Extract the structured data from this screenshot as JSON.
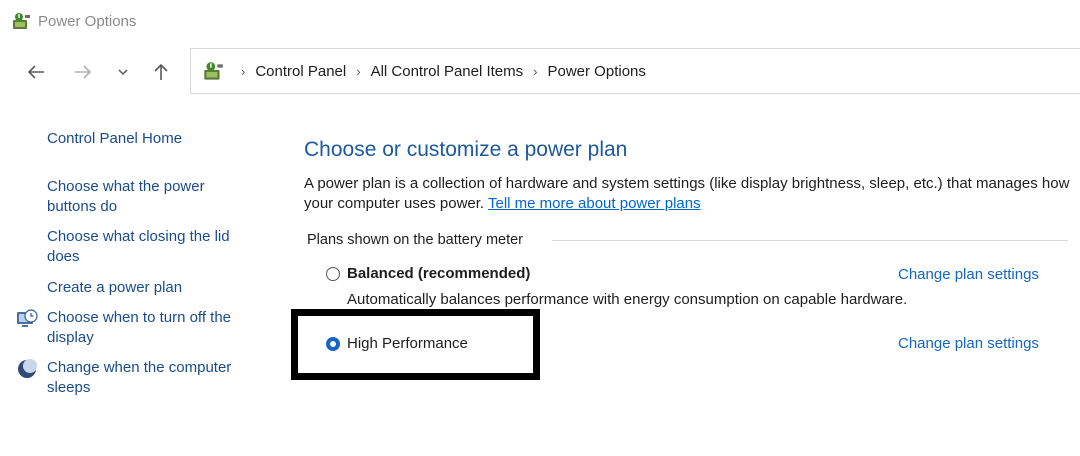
{
  "window": {
    "title": "Power Options",
    "title_icon": "power-options-icon"
  },
  "nav": {
    "back_icon": "back-arrow-icon",
    "forward_icon": "forward-arrow-icon",
    "recent_icon": "chevron-down-icon",
    "up_icon": "up-arrow-icon",
    "breadcrumbs": [
      "Control Panel",
      "All Control Panel Items",
      "Power Options"
    ],
    "separator": "›"
  },
  "sidebar": {
    "items": [
      {
        "label": "Control Panel Home",
        "icon": ""
      },
      {
        "label": "Choose what the power buttons do",
        "icon": ""
      },
      {
        "label": "Choose what closing the lid does",
        "icon": ""
      },
      {
        "label": "Create a power plan",
        "icon": ""
      },
      {
        "label": "Choose when to turn off the display",
        "icon": "display-schedule-icon"
      },
      {
        "label": "Change when the computer sleeps",
        "icon": "moon-sleep-icon"
      }
    ]
  },
  "main": {
    "heading": "Choose or customize a power plan",
    "description": "A power plan is a collection of hardware and system settings (like display brightness, sleep, etc.) that manages how your computer uses power.",
    "learn_more_link": "Tell me more about power plans",
    "group_label": "Plans shown on the battery meter",
    "plans": [
      {
        "name": "Balanced (recommended)",
        "description": "Automatically balances performance with energy consumption on capable hardware.",
        "selected": false,
        "change_label": "Change plan settings"
      },
      {
        "name": "High Performance",
        "description": "",
        "selected": true,
        "change_label": "Change plan settings"
      }
    ]
  },
  "colors": {
    "link": "#1466c5",
    "heading": "#1c5a9e",
    "sidebar_link": "#1a4c8c",
    "highlight_border": "#000000"
  }
}
